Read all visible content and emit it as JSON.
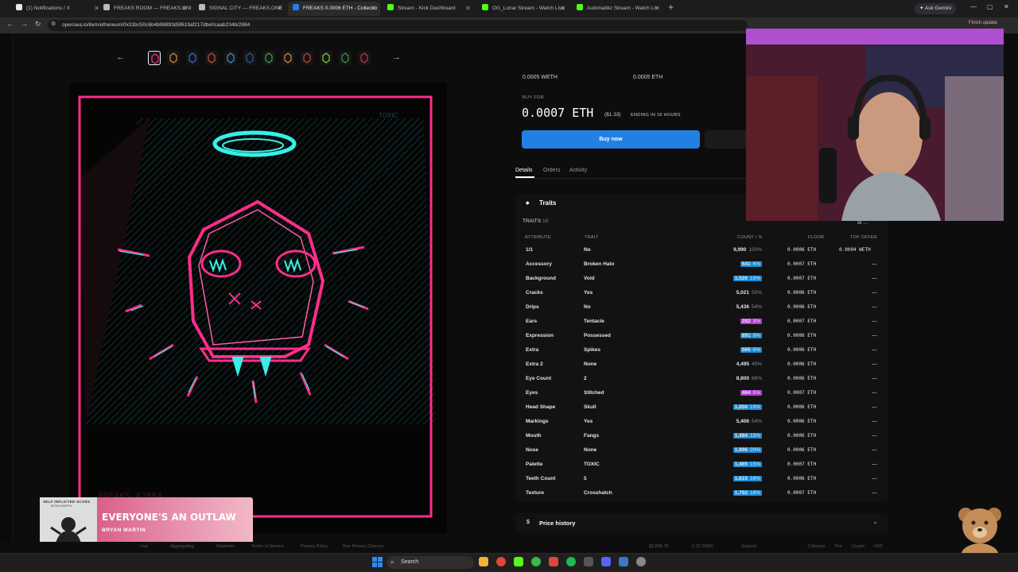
{
  "browser": {
    "tabs": [
      {
        "label": "(1) Notifications / X",
        "color": "#e7e9ea"
      },
      {
        "label": "FREAKS ROOM — FREAKS.ONE",
        "color": "#bbbbbb"
      },
      {
        "label": "SIGNAL CITY — FREAKS.ONE",
        "color": "#bbbbbb"
      },
      {
        "label": "FREAKS 0.0006 ETH - Collectio",
        "color": "#2081e2"
      },
      {
        "label": "Stream - Kick Dashboard",
        "color": "#53fc18"
      },
      {
        "label": "OG_Lunar Stream - Watch Live",
        "color": "#53fc18"
      },
      {
        "label": "Automatikz Stream - Watch Liv",
        "color": "#53fc18"
      }
    ],
    "active_tab_index": 3,
    "ask_gemini": "Ask Gemini",
    "url": "opensea.io/item/ethereum/0x31bc50c6b4b98893d5f619af217dbe0caab234b/2884",
    "finish_update": "Finish update"
  },
  "listing": {
    "top_prices": [
      "0.0005 WETH",
      "0.0005 ETH"
    ],
    "buy_for_label": "BUY FOR",
    "price": "0.0007 ETH",
    "usd": "($1.33)",
    "ending": "ENDING IN 18 HOURS",
    "buy_button": "Buy now"
  },
  "subtabs": [
    "Details",
    "Orders",
    "Activity"
  ],
  "traits": {
    "header": "Traits",
    "count_label": "TRAITS",
    "count": "18",
    "columns": {
      "attribute": "ATTRIBUTE",
      "trait": "TRAIT",
      "count": "COUNT / %",
      "floor": "FLOOR",
      "offer": "TOP OFFER"
    },
    "rows": [
      {
        "attr": "1/1",
        "trait": "No",
        "count": "9,990",
        "pct": "100%",
        "floor": "0.0006 ETH",
        "offer": "0.0004 WETH",
        "hl": ""
      },
      {
        "attr": "Accessory",
        "trait": "Broken Halo",
        "count": "641",
        "pct": "6%",
        "floor": "0.0007 ETH",
        "offer": "—",
        "hl": "#1d8bd6"
      },
      {
        "attr": "Background",
        "trait": "Void",
        "count": "1,526",
        "pct": "15%",
        "floor": "0.0007 ETH",
        "offer": "—",
        "hl": "#1d8bd6"
      },
      {
        "attr": "Cracks",
        "trait": "Yes",
        "count": "5,021",
        "pct": "50%",
        "floor": "0.0006 ETH",
        "offer": "—",
        "hl": ""
      },
      {
        "attr": "Drips",
        "trait": "No",
        "count": "5,436",
        "pct": "54%",
        "floor": "0.0006 ETH",
        "offer": "—",
        "hl": ""
      },
      {
        "attr": "Ears",
        "trait": "Tentacle",
        "count": "282",
        "pct": "3%",
        "floor": "0.0007 ETH",
        "offer": "—",
        "hl": "#b13fd1"
      },
      {
        "attr": "Expression",
        "trait": "Possessed",
        "count": "891",
        "pct": "9%",
        "floor": "0.0006 ETH",
        "offer": "—",
        "hl": "#1d8bd6"
      },
      {
        "attr": "Extra",
        "trait": "Spikes",
        "count": "565",
        "pct": "6%",
        "floor": "0.0006 ETH",
        "offer": "—",
        "hl": "#1d8bd6"
      },
      {
        "attr": "Extra 2",
        "trait": "None",
        "count": "4,495",
        "pct": "45%",
        "floor": "0.0006 ETH",
        "offer": "—",
        "hl": ""
      },
      {
        "attr": "Eye Count",
        "trait": "2",
        "count": "8,800",
        "pct": "88%",
        "floor": "0.0006 ETH",
        "offer": "—",
        "hl": ""
      },
      {
        "attr": "Eyes",
        "trait": "Stitched",
        "count": "484",
        "pct": "5%",
        "floor": "0.0007 ETH",
        "offer": "—",
        "hl": "#b13fd1"
      },
      {
        "attr": "Head Shape",
        "trait": "Skull",
        "count": "1,856",
        "pct": "19%",
        "floor": "0.0006 ETH",
        "offer": "—",
        "hl": "#1d8bd6"
      },
      {
        "attr": "Markings",
        "trait": "Yes",
        "count": "5,406",
        "pct": "54%",
        "floor": "0.0006 ETH",
        "offer": "—",
        "hl": ""
      },
      {
        "attr": "Mouth",
        "trait": "Fangs",
        "count": "1,484",
        "pct": "15%",
        "floor": "0.0006 ETH",
        "offer": "—",
        "hl": "#1d8bd6"
      },
      {
        "attr": "Nose",
        "trait": "None",
        "count": "1,996",
        "pct": "20%",
        "floor": "0.0006 ETH",
        "offer": "—",
        "hl": "#1d8bd6"
      },
      {
        "attr": "Palette",
        "trait": "TOXIC",
        "count": "1,465",
        "pct": "15%",
        "floor": "0.0007 ETH",
        "offer": "—",
        "hl": "#1d8bd6"
      },
      {
        "attr": "Teeth Count",
        "trait": "5",
        "count": "1,615",
        "pct": "16%",
        "floor": "0.0006 ETH",
        "offer": "—",
        "hl": "#1d8bd6"
      },
      {
        "attr": "Texture",
        "trait": "Crosshatch",
        "count": "1,783",
        "pct": "18%",
        "floor": "0.0007 ETH",
        "offer": "—",
        "hl": "#1d8bd6"
      }
    ]
  },
  "price_history": "Price history",
  "artwork": {
    "palette_tag": "TOXIC",
    "watermark": "FREAKS #2884"
  },
  "footer_links": [
    "Live",
    "Aggregating",
    "Networks",
    "Terms of Service",
    "Privacy Policy",
    "Your Privacy Choices",
    "$2,006.78",
    "0.12 GWEI",
    "Support",
    "Collector",
    "Pro",
    "Crypto",
    "USD"
  ],
  "now_playing": {
    "song": "EVERYONE'S AN OUTLAW",
    "artist": "BRYAN MARTIN",
    "album_title": "SELF INFLICTED SCARS",
    "album_sub": "BRYAN MARTIN"
  },
  "taskbar": {
    "search": "Search"
  }
}
